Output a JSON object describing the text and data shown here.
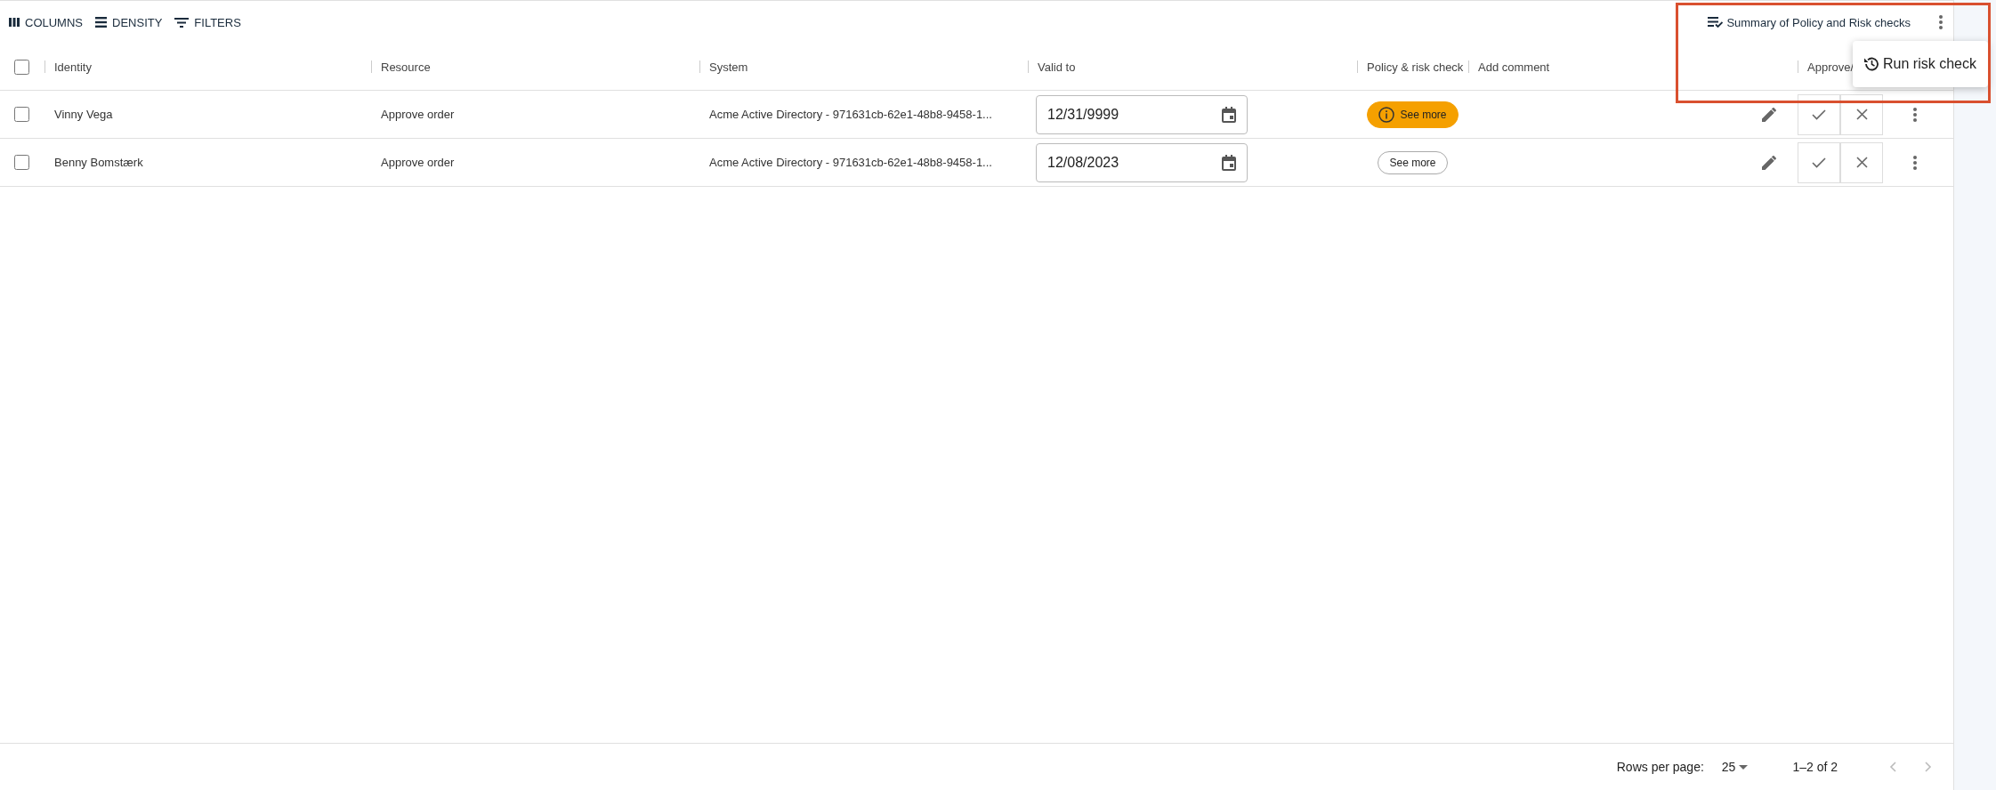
{
  "toolbar": {
    "buttons": [
      {
        "kind": "columns",
        "label": "COLUMNS"
      },
      {
        "kind": "density",
        "label": "DENSITY"
      },
      {
        "kind": "filters",
        "label": "FILTERS"
      }
    ],
    "summary_button": "Summary of Policy and Risk checks"
  },
  "menu": {
    "items": [
      "Run risk check"
    ]
  },
  "table": {
    "all_selected": false,
    "columns": [
      "Identity",
      "Resource",
      "System",
      "Valid to",
      "Policy & risk check",
      "Add comment",
      "Approve/"
    ],
    "rows": [
      {
        "selected": false,
        "identity": "Vinny Vega",
        "resource": "Approve order",
        "system": "Acme Active Directory - 971631cb-62e1-48b8-9458-1...",
        "valid_to": "12/31/9999",
        "policy": {
          "label": "See more",
          "flagged": true
        }
      },
      {
        "selected": false,
        "identity": "Benny Bomstærk",
        "resource": "Approve order",
        "system": "Acme Active Directory - 971631cb-62e1-48b8-9458-1...",
        "valid_to": "12/08/2023",
        "policy": {
          "label": "See more",
          "flagged": false
        }
      }
    ]
  },
  "footer": {
    "rows_per_page_label": "Rows per page:",
    "rows_per_page": "25",
    "range": "1–2 of 2"
  }
}
